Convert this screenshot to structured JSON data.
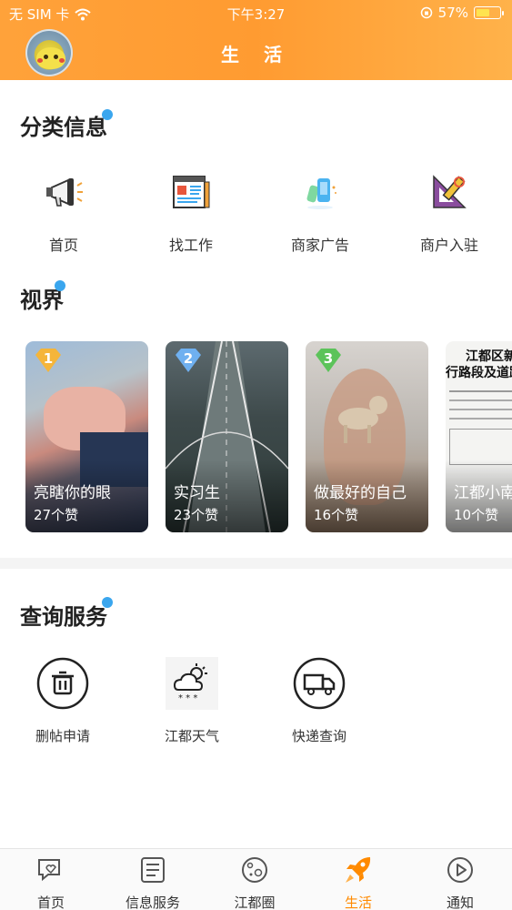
{
  "status_bar": {
    "carrier": "无 SIM 卡",
    "time": "下午3:27",
    "battery": "57%"
  },
  "header": {
    "title": "生 活"
  },
  "category_section": {
    "title": "分类信息",
    "items": [
      {
        "label": "首页",
        "icon": "megaphone-icon"
      },
      {
        "label": "找工作",
        "icon": "newspaper-icon"
      },
      {
        "label": "商家广告",
        "icon": "phone-ad-icon"
      },
      {
        "label": "商户入驻",
        "icon": "ruler-tools-icon"
      }
    ]
  },
  "vision_section": {
    "title": "视界",
    "cards": [
      {
        "rank": "1",
        "title": "亮瞎你的眼",
        "likes": "27个赞",
        "badge_color": "#f5b53a"
      },
      {
        "rank": "2",
        "title": "实习生",
        "likes": "23个赞",
        "badge_color": "#6fb0f0"
      },
      {
        "rank": "3",
        "title": "做最好的自己",
        "likes": "16个赞",
        "badge_color": "#5cc35a"
      },
      {
        "rank": "",
        "title": "江都小南",
        "likes": "10个赞",
        "badge_color": ""
      }
    ],
    "doc_text": {
      "line1": "江都区新城",
      "line2": "行路段及道路"
    }
  },
  "query_section": {
    "title": "查询服务",
    "items": [
      {
        "label": "删帖申请",
        "icon": "trash-icon"
      },
      {
        "label": "江都天气",
        "icon": "weather-icon"
      },
      {
        "label": "快递查询",
        "icon": "truck-icon"
      }
    ]
  },
  "tabbar": {
    "items": [
      {
        "label": "首页",
        "icon": "home-chat-icon",
        "active": false
      },
      {
        "label": "信息服务",
        "icon": "list-icon",
        "active": false
      },
      {
        "label": "江都圈",
        "icon": "planet-icon",
        "active": false
      },
      {
        "label": "生活",
        "icon": "rocket-icon",
        "active": true
      },
      {
        "label": "通知",
        "icon": "play-icon",
        "active": false
      }
    ],
    "active_color": "#ff8a00"
  },
  "colors": {
    "header_orange": "#ff9b31",
    "accent_blue": "#3aa6ee"
  }
}
